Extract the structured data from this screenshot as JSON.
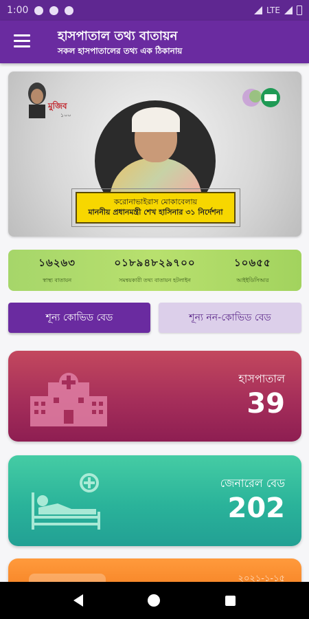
{
  "status_bar": {
    "time": "1:00",
    "network": "LTE"
  },
  "app_bar": {
    "title": "হাসপাতাল তথ্য বাতায়ন",
    "subtitle": "সকল হাসপাতালের তথ্য এক ঠিকানায়"
  },
  "banner": {
    "caption_line1": "করোনাভাইরাস মোকাবেলায়",
    "caption_line2": "মাননীয় প্রধানমন্ত্রী শেখ হাসিনার ৩১ নির্দেশনা"
  },
  "info_strip": [
    {
      "number": "১৬২৬৩",
      "label": "স্বাস্থ্য বাতায়ন"
    },
    {
      "number": "০১৮৯৪৮২৯৭০০",
      "label": "সমন্বয়কারী তথ্য বাতায়ন হটলাইন"
    },
    {
      "number": "১০৬৫৫",
      "label": "আইইডিসিআর"
    }
  ],
  "tabs": [
    {
      "label": "শূন্য কোভিড বেড",
      "active": true
    },
    {
      "label": "শূন্য নন-কোভিড বেড",
      "active": false
    }
  ],
  "cards": [
    {
      "title": "হাসপাতাল",
      "value": "39",
      "icon": "hospital-icon"
    },
    {
      "title": "জেনারেল বেড",
      "value": "202",
      "icon": "patient-bed-icon"
    }
  ],
  "partial_card": {
    "text": "২০২১-১-১৫"
  },
  "colors": {
    "primary": "#6a2ba0",
    "status_bar": "#5f2791",
    "tab_inactive": "#dccfea",
    "info_strip": "#b2dc6a",
    "card_hospital": "#a52e5a",
    "card_general": "#2ab39a",
    "card_orange": "#f37d1f"
  }
}
